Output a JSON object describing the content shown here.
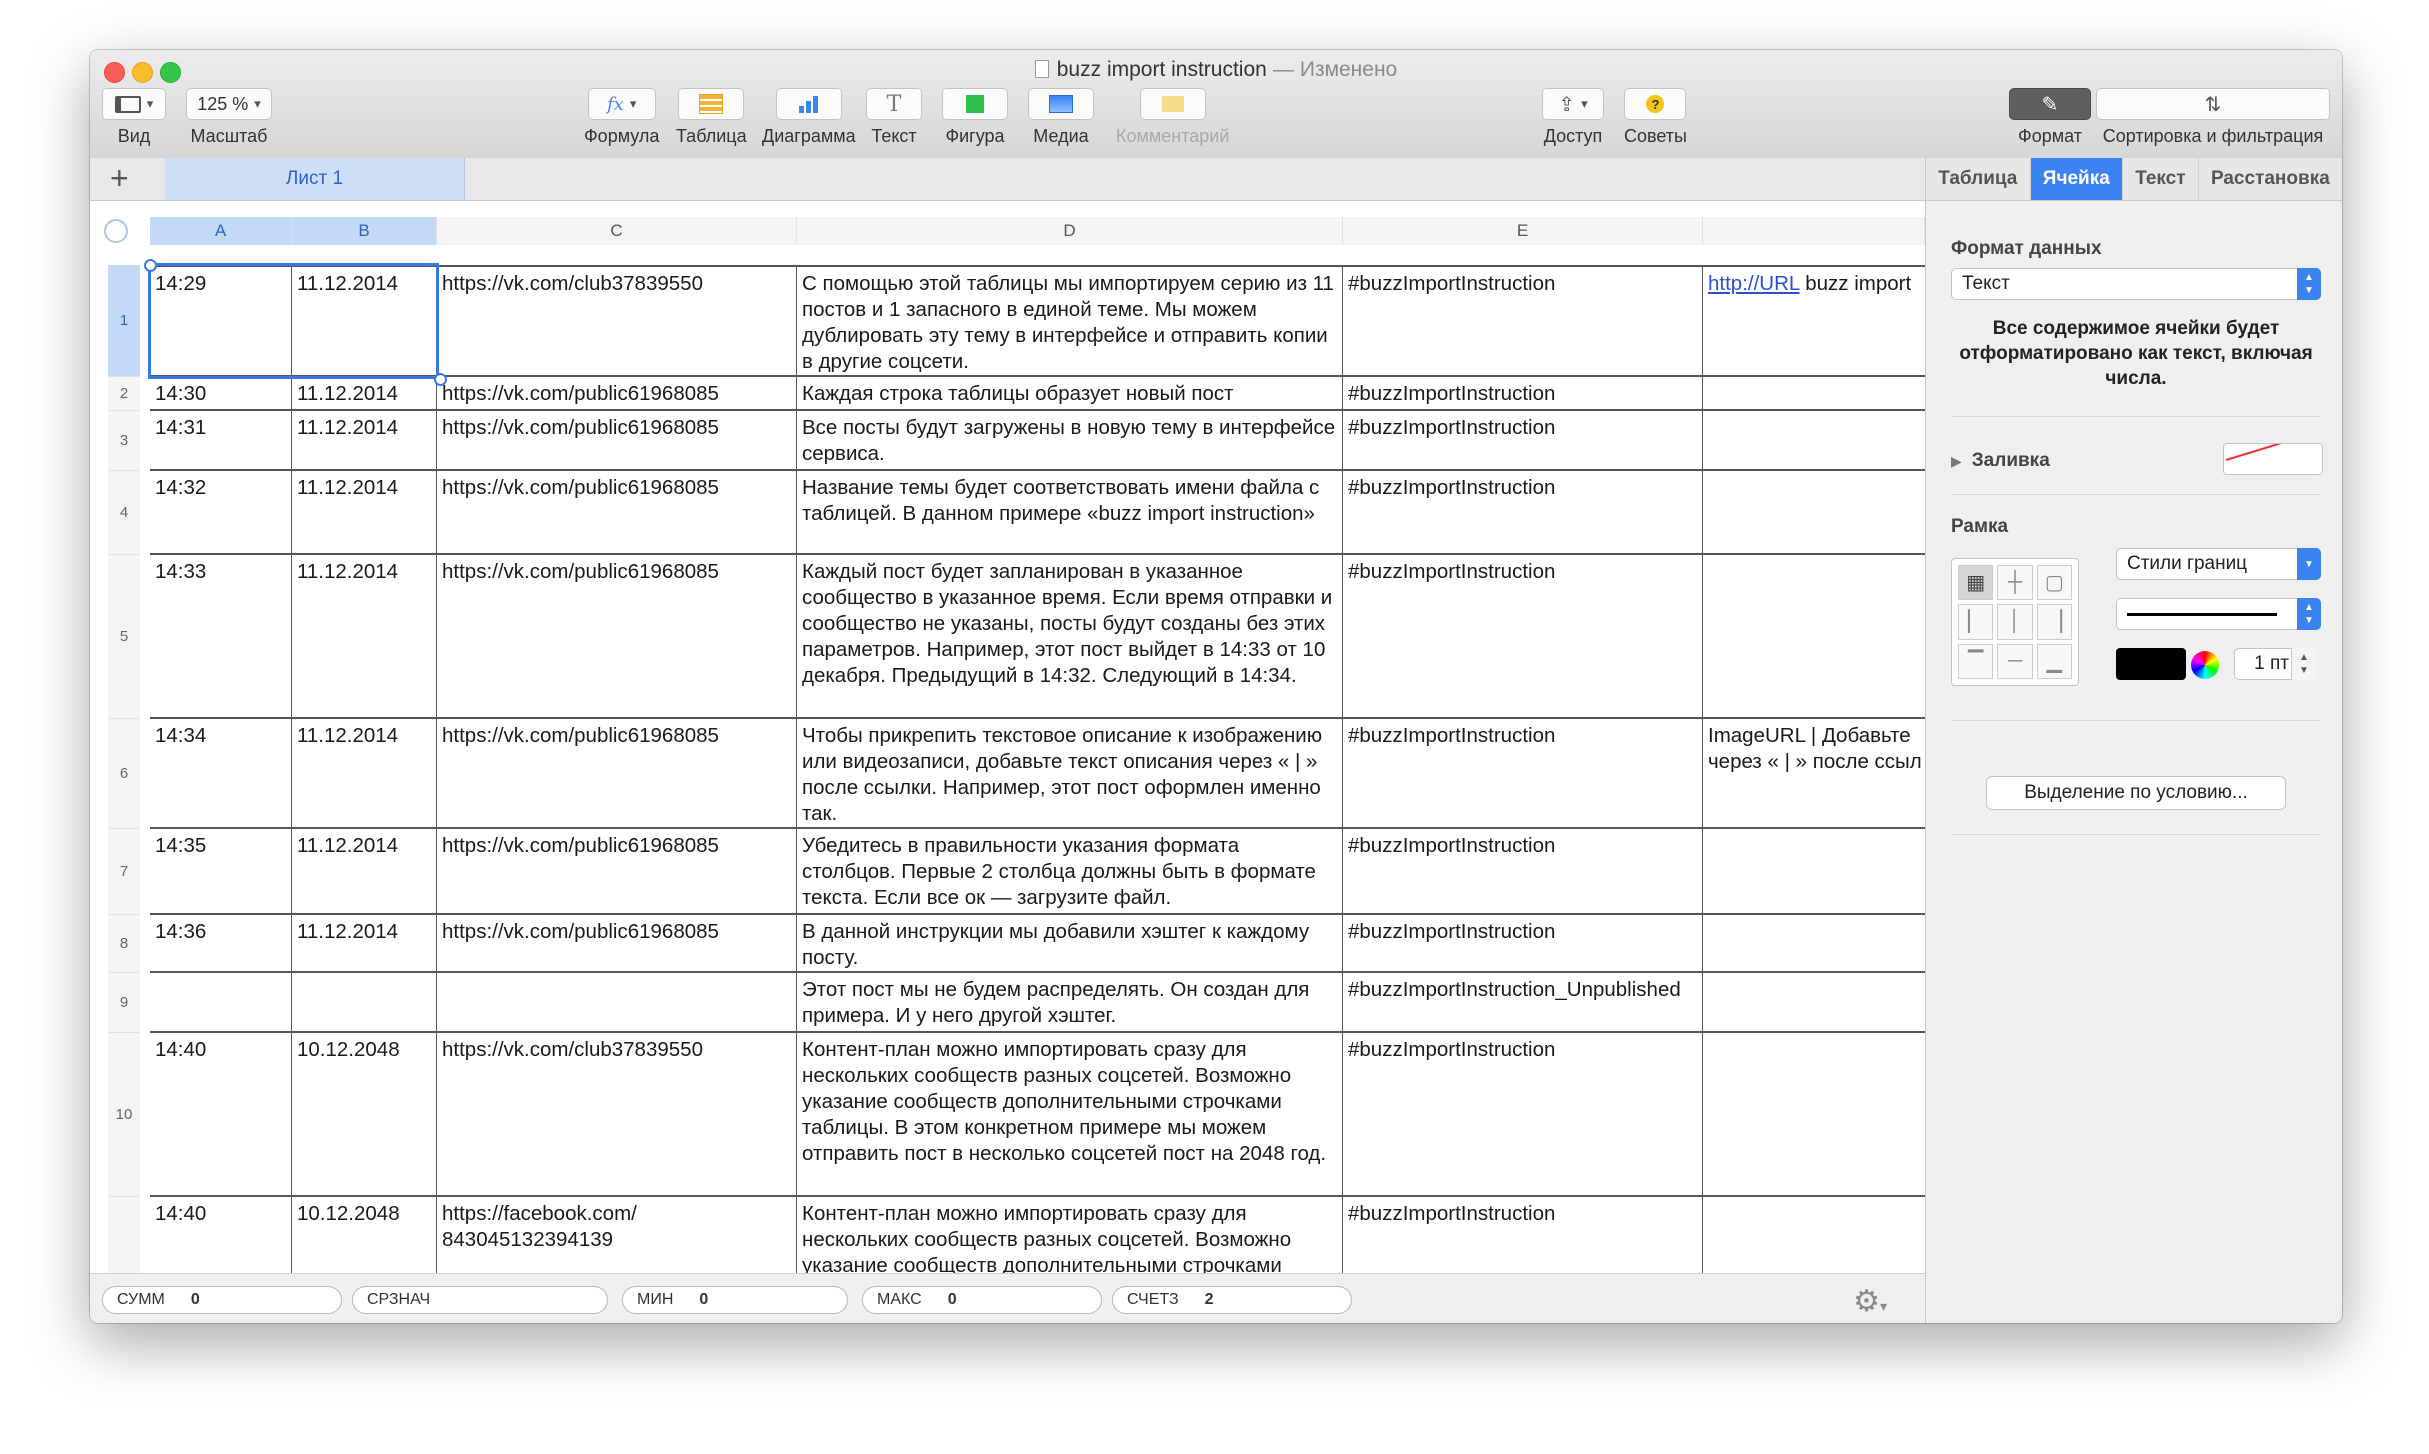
{
  "window": {
    "title": "buzz import instruction",
    "separator": "—",
    "status": "Изменено"
  },
  "toolbar": {
    "view": "Вид",
    "zoom_value": "125 %",
    "zoom": "Масштаб",
    "formula_icon": "fx",
    "formula": "Формула",
    "table": "Таблица",
    "chart": "Диаграмма",
    "text_icon": "T",
    "text": "Текст",
    "shape": "Фигура",
    "media": "Медиа",
    "comment": "Комментарий",
    "share": "Доступ",
    "tips": "Советы",
    "tips_icon": "?",
    "format": "Формат",
    "sort": "Сортировка и фильтрация"
  },
  "sheet": {
    "add": "+",
    "tab": "Лист 1"
  },
  "columns": [
    "A",
    "B",
    "C",
    "D",
    "E"
  ],
  "rows": [
    {
      "n": "1",
      "a": "14:29",
      "b": "11.12.2014",
      "c": "https://vk.com/club37839550",
      "d": "С помощью этой таблицы мы импортируем серию из 11 постов и 1 запасного в единой теме. Мы можем дублировать эту тему в интерфейсе и отправить копии в другие соцсети.",
      "e": "#buzzImportInstruction",
      "f_link": "http://URL",
      "f_rest": " buzz import"
    },
    {
      "n": "2",
      "a": "14:30",
      "b": "11.12.2014",
      "c": "https://vk.com/public61968085",
      "d": "Каждая строка таблицы образует новый пост",
      "e": "#buzzImportInstruction",
      "f": ""
    },
    {
      "n": "3",
      "a": "14:31",
      "b": "11.12.2014",
      "c": "https://vk.com/public61968085",
      "d": "Все посты будут загружены в новую тему в интерфейсе сервиса.",
      "e": "#buzzImportInstruction",
      "f": ""
    },
    {
      "n": "4",
      "a": "14:32",
      "b": "11.12.2014",
      "c": "https://vk.com/public61968085",
      "d": "Название темы будет соответствовать имени файла с таблицей. В данном примере «buzz import instruction»",
      "e": "#buzzImportInstruction",
      "f": ""
    },
    {
      "n": "5",
      "a": "14:33",
      "b": "11.12.2014",
      "c": "https://vk.com/public61968085",
      "d": "Каждый пост будет запланирован в указанное сообщество в указанное время. Если время отправки и сообщество не указаны, посты будут созданы без этих параметров. Например, этот пост выйдет в 14:33 от 10 декабря. Предыдущий в 14:32. Следующий в 14:34.",
      "e": "#buzzImportInstruction",
      "f": ""
    },
    {
      "n": "6",
      "a": "14:34",
      "b": "11.12.2014",
      "c": "https://vk.com/public61968085",
      "d": "Чтобы прикрепить текстовое описание к изображению или видеозаписи, добавьте текст описания через « | » после ссылки. Например, этот пост оформлен именно так.",
      "e": "#buzzImportInstruction",
      "f": "ImageURL | Добавьте через « | » после ссыл"
    },
    {
      "n": "7",
      "a": "14:35",
      "b": "11.12.2014",
      "c": "https://vk.com/public61968085",
      "d": "Убедитесь в правильности указания формата столбцов. Первые 2 столбца должны быть в формате текста. Если все ок — загрузите файл.",
      "e": "#buzzImportInstruction",
      "f": ""
    },
    {
      "n": "8",
      "a": "14:36",
      "b": "11.12.2014",
      "c": "https://vk.com/public61968085",
      "d": "В данной инструкции мы добавили хэштег к каждому посту.",
      "e": "#buzzImportInstruction",
      "f": ""
    },
    {
      "n": "9",
      "a": "",
      "b": "",
      "c": "",
      "d": "Этот пост мы не будем распределять. Он создан для примера. И у него другой хэштег.",
      "e": "#buzzImportInstruction_Unpublished",
      "f": ""
    },
    {
      "n": "10",
      "a": "14:40",
      "b": "10.12.2048",
      "c": "https://vk.com/club37839550",
      "d": "Контент-план можно импортировать сразу для нескольких сообществ разных соцсетей. Возможно указание сообществ дополнительными строчками таблицы. В этом конкретном примере мы можем отправить пост в несколько соцсетей пост на 2048 год.",
      "e": "#buzzImportInstruction",
      "f": ""
    },
    {
      "n": "",
      "a": "14:40",
      "b": "10.12.2048",
      "c": "https://facebook.com/ 843045132394139",
      "d": "Контент-план можно импортировать сразу для нескольких сообществ разных соцсетей. Возможно указание сообществ дополнительными строчками",
      "e": "#buzzImportInstruction",
      "f": ""
    }
  ],
  "status_bar": {
    "sum_label": "СУММ",
    "sum": "0",
    "avg_label": "СРЗНАЧ",
    "min_label": "МИН",
    "min": "0",
    "max_label": "МАКС",
    "max": "0",
    "count_label": "СЧЕТЗ",
    "count": "2"
  },
  "inspector": {
    "tabs": [
      "Таблица",
      "Ячейка",
      "Текст",
      "Расстановка"
    ],
    "active_tab": "Ячейка",
    "data_format_heading": "Формат данных",
    "data_format_value": "Текст",
    "data_format_note": "Все содержимое ячейки будет отформатировано как текст, включая числа.",
    "fill": "Заливка",
    "border_heading": "Рамка",
    "border_styles": "Стили границ",
    "border_width": "1 пт",
    "conditional": "Выделение по условию..."
  },
  "colors": {
    "accent": "#3b83f0",
    "selection": "#3b78e7",
    "link": "#2c4fd1"
  }
}
